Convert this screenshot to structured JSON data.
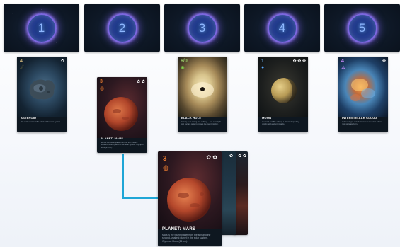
{
  "slots": [
    {
      "number": "1"
    },
    {
      "number": "2"
    },
    {
      "number": "3"
    },
    {
      "number": "4"
    },
    {
      "number": "5"
    }
  ],
  "cards": {
    "asteroid": {
      "cost": "4",
      "stars": "✿",
      "title": "ASTEROID",
      "text": "The rocky and metallic debris of the solar system.",
      "cost_color": "#c7b07a"
    },
    "mars_small": {
      "cost": "3",
      "stars": "✿ ✿",
      "title": "PLANET: MARS",
      "text": "Mars is the fourth planet from the sun and the second-smallest planet in the solar system. Olympus Mons (21 km).",
      "cost_color": "#e0762f"
    },
    "black_hole": {
      "cost": "6/0",
      "stars": "",
      "title": "BLACK HOLE",
      "text": "Gravity is so strong that nothing — not even light — can escape once it crosses the event horizon.",
      "cost_color": "#9fd16b"
    },
    "moon": {
      "cost": "1",
      "stars": "✿ ✿ ✿",
      "title": "MOON",
      "text": "A natural satellite orbiting a planet, shaped by gravity and ancient impacts.",
      "cost_color": "#7ec3ff"
    },
    "interstellar": {
      "cost": "4",
      "stars": "✿",
      "title": "INTERSTELLAR CLOUD",
      "text": "A cloud of gas and dust between the stars where new stars are born.",
      "cost_color": "#c78cff"
    },
    "mars_large": {
      "cost": "3",
      "stars": "✿ ✿",
      "title": "PLANET: MARS",
      "text": "Mars is the fourth planet from the sun and the second-smallest planet in the solar system. Olympus Mons (21 km).",
      "cost_color": "#e0762f"
    },
    "stack_1": {
      "stars": "✿"
    },
    "stack_2": {
      "stars": "✿ ✿"
    }
  },
  "colors": {
    "connector": "#1fa6d6",
    "orb_ring": "#7d68e0"
  }
}
